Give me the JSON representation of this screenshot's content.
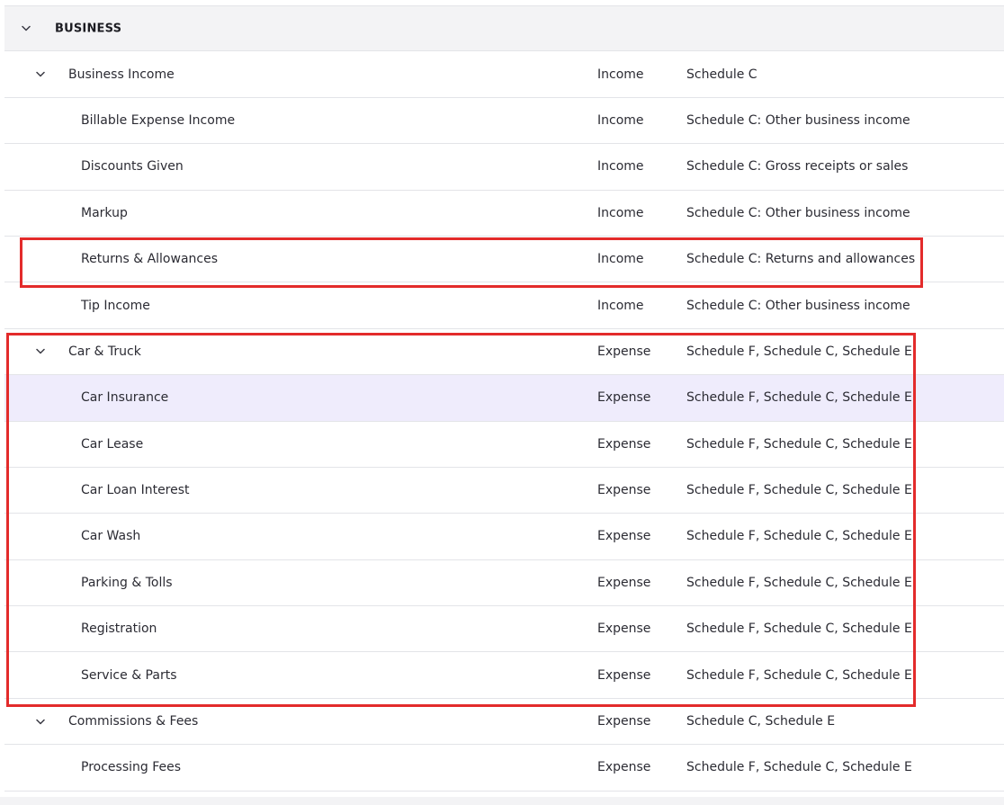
{
  "section": {
    "label": "BUSINESS"
  },
  "rows": [
    {
      "kind": "group",
      "name": "Business Income",
      "type": "Income",
      "tax": "Schedule C"
    },
    {
      "kind": "child",
      "name": "Billable Expense Income",
      "type": "Income",
      "tax": "Schedule C: Other business income"
    },
    {
      "kind": "child",
      "name": "Discounts Given",
      "type": "Income",
      "tax": "Schedule C: Gross receipts or sales"
    },
    {
      "kind": "child",
      "name": "Markup",
      "type": "Income",
      "tax": "Schedule C: Other business income"
    },
    {
      "kind": "child",
      "name": "Returns & Allowances",
      "type": "Income",
      "tax": "Schedule C: Returns and allowances"
    },
    {
      "kind": "child",
      "name": "Tip Income",
      "type": "Income",
      "tax": "Schedule C: Other business income"
    },
    {
      "kind": "group",
      "name": "Car & Truck",
      "type": "Expense",
      "tax": "Schedule F, Schedule C, Schedule E"
    },
    {
      "kind": "child",
      "name": "Car Insurance",
      "type": "Expense",
      "tax": "Schedule F, Schedule C, Schedule E",
      "highlighted": true
    },
    {
      "kind": "child",
      "name": "Car Lease",
      "type": "Expense",
      "tax": "Schedule F, Schedule C, Schedule E"
    },
    {
      "kind": "child",
      "name": "Car Loan Interest",
      "type": "Expense",
      "tax": "Schedule F, Schedule C, Schedule E"
    },
    {
      "kind": "child",
      "name": "Car Wash",
      "type": "Expense",
      "tax": "Schedule F, Schedule C, Schedule E"
    },
    {
      "kind": "child",
      "name": "Parking & Tolls",
      "type": "Expense",
      "tax": "Schedule F, Schedule C, Schedule E"
    },
    {
      "kind": "child",
      "name": "Registration",
      "type": "Expense",
      "tax": "Schedule F, Schedule C, Schedule E"
    },
    {
      "kind": "child",
      "name": "Service & Parts",
      "type": "Expense",
      "tax": "Schedule F, Schedule C, Schedule E"
    },
    {
      "kind": "group",
      "name": "Commissions & Fees",
      "type": "Expense",
      "tax": "Schedule C, Schedule E"
    },
    {
      "kind": "child",
      "name": "Processing Fees",
      "type": "Expense",
      "tax": "Schedule F, Schedule C, Schedule E"
    }
  ],
  "icons": {
    "expand": "chevron-down-icon"
  },
  "colors": {
    "annotation": "#e32b2b",
    "highlight_row": "#efecfc",
    "section_bg": "#f3f3f5"
  }
}
